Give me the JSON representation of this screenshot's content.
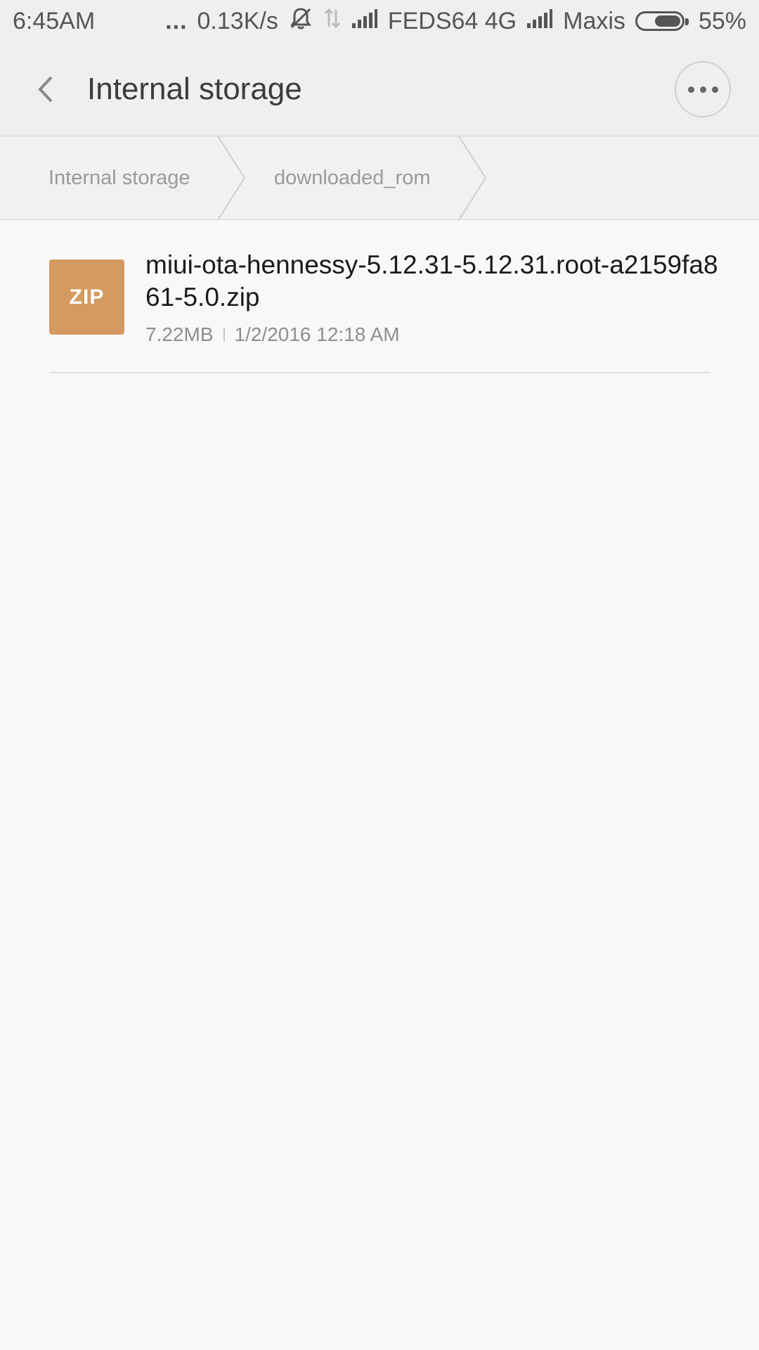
{
  "status_bar": {
    "time": "6:45AM",
    "dots": "...",
    "speed": "0.13K/s",
    "carrier1": "FEDS64 4G",
    "carrier2": "Maxis",
    "battery": "55%",
    "icons": [
      "mute-icon",
      "data-transfer-icon",
      "signal-icon",
      "signal-icon",
      "battery-icon"
    ]
  },
  "header": {
    "title": "Internal storage",
    "back_icon": "chevron-left-icon",
    "more_icon": "more-dots-icon"
  },
  "breadcrumb": {
    "items": [
      {
        "label": "Internal storage"
      },
      {
        "label": "downloaded_rom"
      }
    ]
  },
  "files": [
    {
      "icon_label": "ZIP",
      "name": "miui-ota-hennessy-5.12.31-5.12.31.root-a2159fa861-5.0.zip",
      "size": "7.22MB",
      "date": "1/2/2016 12:18 AM"
    }
  ],
  "colors": {
    "zip_icon": "#d59a5f",
    "bar_bg": "#efefef",
    "page_bg": "#f8f8f8"
  }
}
